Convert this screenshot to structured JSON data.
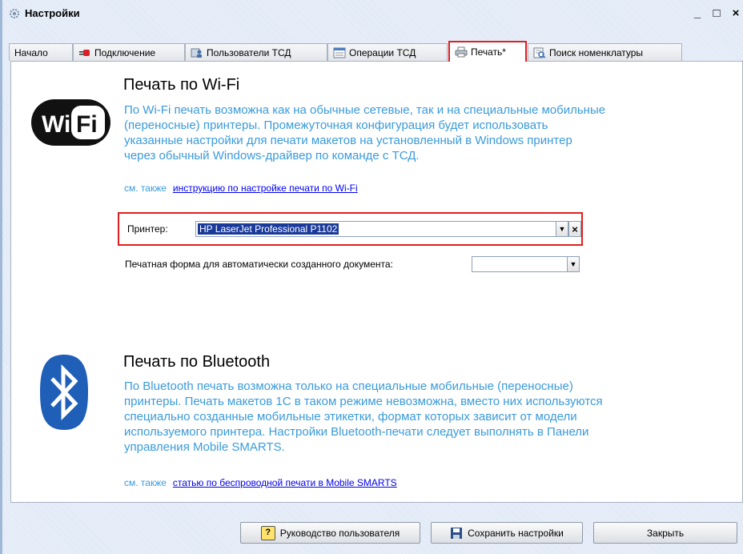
{
  "window": {
    "title": "Настройки",
    "controls": {
      "minimize": "_",
      "maximize": "□",
      "close": "×"
    }
  },
  "tabs": [
    {
      "label": "Начало",
      "icon": "none"
    },
    {
      "label": "Подключение",
      "icon": "plug-icon"
    },
    {
      "label": "Пользователи ТСД",
      "icon": "users-icon"
    },
    {
      "label": "Операции ТСД",
      "icon": "list-icon"
    },
    {
      "label": "Печать*",
      "icon": "printer-icon",
      "active": true
    },
    {
      "label": "Поиск номенклатуры",
      "icon": "search-doc-icon"
    }
  ],
  "wifi": {
    "logo_text": "WiFi",
    "title": "Печать по Wi-Fi",
    "desc_lines": [
      "По Wi-Fi печать возможна как на обычные сетевые, так и на специальные мобильные",
      "(переносные) принтеры.  Промежуточная конфигурация будет использовать",
      "указанные настройки для печати макетов на установленный в Windows принтер",
      "через обычный Windows-драйвер по команде с ТСД."
    ],
    "see_also": "см. также",
    "link": "инструкцию по настройке печати по Wi-Fi"
  },
  "printer": {
    "label": "Принтер:",
    "value": "HP LaserJet Professional P1102",
    "dropdown_icon": "▼",
    "clear_icon": "×"
  },
  "print_form": {
    "label": "Печатная форма для автоматически созданного документа:",
    "value": ""
  },
  "bluetooth": {
    "title": "Печать по Bluetooth",
    "desc_lines": [
      "По Bluetooth печать возможна только на специальные мобильные (переносные)",
      "принтеры.  Печать макетов 1С в таком режиме невозможна, вместо них используются",
      "специально созданные мобильные этикетки, формат которых зависит от модели",
      "используемого принтера.  Настройки Bluetooth-печати следует выполнять в Панели",
      "управления Mobile SMARTS."
    ],
    "see_also": "см. также",
    "link": "статью по беспроводной печати в Mobile SMARTS"
  },
  "footer": {
    "help_label": "Руководство пользователя",
    "help_icon": "?",
    "save_label": "Сохранить настройки",
    "close_label": "Закрыть"
  },
  "colors": {
    "accent_text": "#3a9bdc",
    "link": "#0000ee",
    "highlight_border": "#e02020",
    "selection": "#1a3a9a"
  }
}
